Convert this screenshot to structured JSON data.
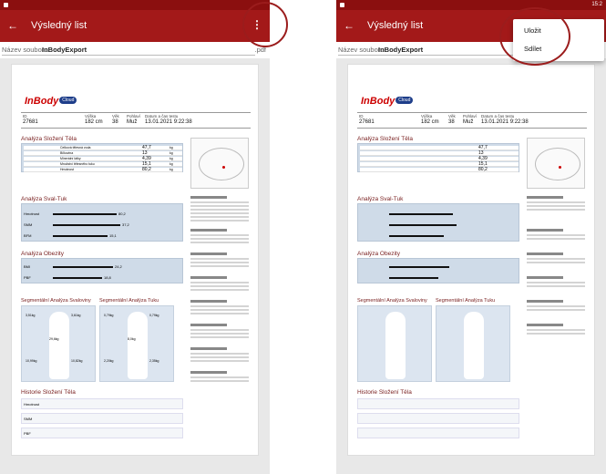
{
  "status": {
    "time": "15:2"
  },
  "appbar": {
    "back_icon": "arrow-back-icon",
    "title": "Výsledný list",
    "more_icon": "more-vert-icon"
  },
  "file": {
    "label": "Název souboru:",
    "name": "InBodyExport",
    "ext": ".pdf"
  },
  "report": {
    "logo_text": "InBody",
    "logo_badge": "Cloud",
    "id_table": {
      "headers": [
        "ID",
        "Výška",
        "Věk",
        "Pohlaví",
        "Datum a čas testu"
      ],
      "values": [
        "27681",
        "182 cm",
        "38",
        "Muž",
        "13.01.2021 9:22:38"
      ]
    },
    "sections": {
      "body_comp": "Analýza Složení Těla",
      "muscle_fat": "Analýza Sval-Tuk",
      "obesity": "Analýza Obezity",
      "seg_muscle": "Segmentální Analýza Svaloviny",
      "seg_fat": "Segmentální Analýza Tuku",
      "history": "Historie Složení Těla"
    },
    "body_comp_rows": [
      {
        "label": "Celková tělesná voda",
        "value": "47,7",
        "unit": "kg"
      },
      {
        "label": "Bílkovina",
        "value": "13",
        "unit": "kg"
      },
      {
        "label": "Minerální látky",
        "value": "4,39",
        "unit": "kg"
      },
      {
        "label": "Množství tělesného tuku",
        "value": "15,1",
        "unit": "kg"
      },
      {
        "label": "Hmotnost",
        "value": "80,2",
        "unit": "kg"
      }
    ],
    "muscle_fat_rows": [
      {
        "label": "Hmotnost",
        "value": "80,2"
      },
      {
        "label": "SMM",
        "value": "37,2"
      },
      {
        "label": "BFM",
        "value": "15,1"
      }
    ],
    "obesity_rows": [
      {
        "label": "BMI",
        "value": "24,2"
      },
      {
        "label": "PBF",
        "value": "18,8"
      }
    ],
    "seg_muscle_values": [
      {
        "kg": "3,51kg",
        "pct": "114,4%",
        "eval": "Normální"
      },
      {
        "kg": "3,61kg",
        "pct": "112,1%",
        "eval": "Normální"
      },
      {
        "kg": "29,6kg",
        "pct": "105,4%",
        "eval": "Normální"
      },
      {
        "kg": "10,99kg",
        "pct": "101,2%",
        "eval": "Normální"
      },
      {
        "kg": "10,82kg",
        "pct": "100,1%",
        "eval": "Normální"
      }
    ],
    "seg_fat_values": [
      {
        "kg": "0,79kg",
        "pct": "14,5%",
        "eval": "Pod"
      },
      {
        "kg": "0,79kg",
        "pct": "15,1%",
        "eval": "Pod"
      },
      {
        "kg": "8,0kg",
        "pct": "20,7%",
        "eval": "Pod"
      },
      {
        "kg": "2,20kg",
        "pct": "16,4%",
        "eval": "Pod"
      },
      {
        "kg": "2,35kg",
        "pct": "16,5%",
        "eval": "Pod"
      }
    ],
    "history_rows": [
      "Hmotnost",
      "SMM",
      "PBF"
    ]
  },
  "menu": {
    "save": "Uložit",
    "share": "Sdílet"
  }
}
